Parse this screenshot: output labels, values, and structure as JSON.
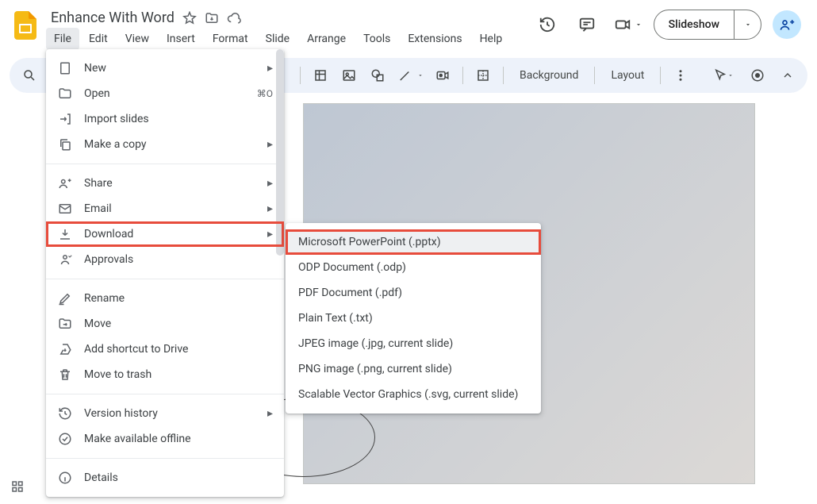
{
  "doc": {
    "title": "Enhance With Word"
  },
  "menubar": {
    "items": [
      "File",
      "Edit",
      "View",
      "Insert",
      "Format",
      "Slide",
      "Arrange",
      "Tools",
      "Extensions",
      "Help"
    ]
  },
  "topbar": {
    "slideshow_label": "Slideshow"
  },
  "toolbar": {
    "background": "Background",
    "layout": "Layout"
  },
  "file_menu": {
    "new": {
      "label": "New"
    },
    "open": {
      "label": "Open",
      "shortcut": "⌘O"
    },
    "import_slides": {
      "label": "Import slides"
    },
    "make_copy": {
      "label": "Make a copy"
    },
    "share": {
      "label": "Share"
    },
    "email": {
      "label": "Email"
    },
    "download": {
      "label": "Download"
    },
    "approvals": {
      "label": "Approvals"
    },
    "rename": {
      "label": "Rename"
    },
    "move": {
      "label": "Move"
    },
    "shortcut": {
      "label": "Add shortcut to Drive"
    },
    "trash": {
      "label": "Move to trash"
    },
    "version": {
      "label": "Version history"
    },
    "offline": {
      "label": "Make available offline"
    },
    "details": {
      "label": "Details"
    }
  },
  "download_menu": {
    "items": [
      "Microsoft PowerPoint (.pptx)",
      "ODP Document (.odp)",
      "PDF Document (.pdf)",
      "Plain Text (.txt)",
      "JPEG image (.jpg, current slide)",
      "PNG image (.png, current slide)",
      "Scalable Vector Graphics (.svg, current slide)"
    ]
  }
}
